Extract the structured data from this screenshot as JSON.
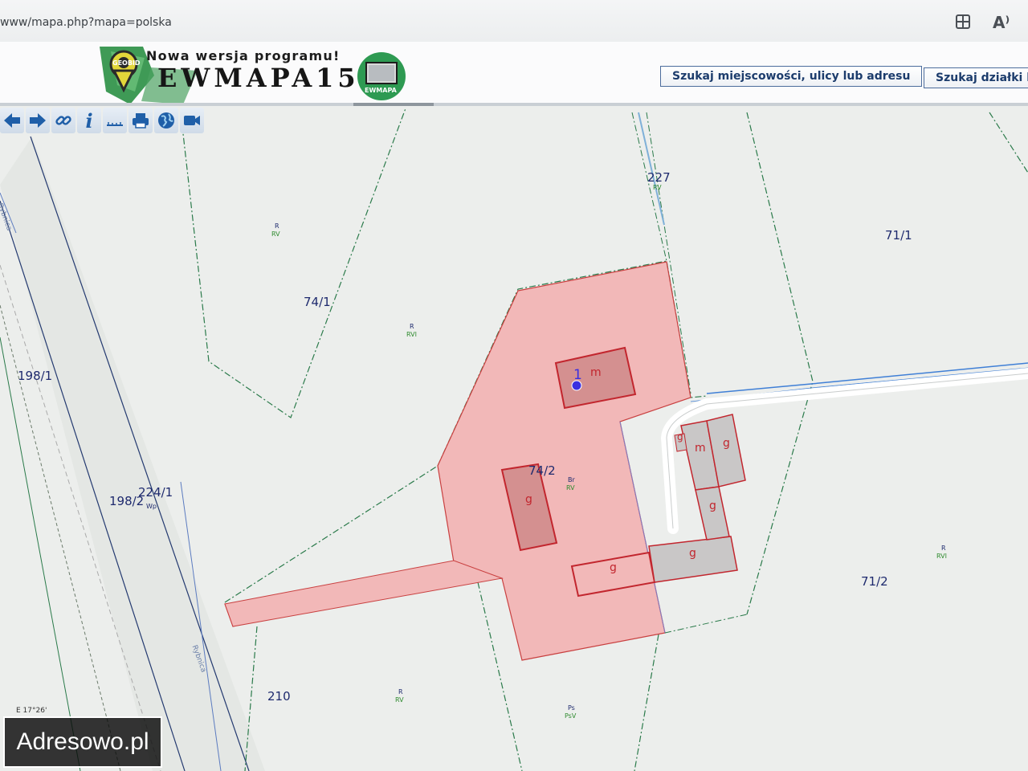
{
  "browser": {
    "url": "www/mapa.php?mapa=polska",
    "icons": [
      "split-view-icon",
      "read-aloud-icon"
    ],
    "read_aloud_glyph": "A⁾"
  },
  "header": {
    "tagline": "Nowa wersja programu!",
    "title": "EWMAPA15",
    "logo_small_text": "GEOBID",
    "monitor_caption": "EWMAPA",
    "search_address_label": "Szukaj miejscowości, ulicy lub adresu",
    "search_parcel_label": "Szukaj działki lu"
  },
  "toolbar": {
    "tools": [
      "back-icon",
      "forward-icon",
      "link-icon",
      "info-icon",
      "measure-icon",
      "print-icon",
      "globe-icon",
      "camera-icon"
    ],
    "info_glyph": "i"
  },
  "map": {
    "colors": {
      "parcel_fill": "#f2b8b8",
      "parcel_outline": "#c94040",
      "building_fill": "#d49090",
      "boundary": "#2a7a4a",
      "road_line": "#3f7fd6",
      "garage_fill": "#c9c7c7"
    },
    "parcels": {
      "p227": "227",
      "p71_1": "71/1",
      "p74_1": "74/1",
      "p198_1": "198/1",
      "p74_2": "74/2",
      "p224_1": "224/1",
      "p198_2": "198/2",
      "p71_2": "71/2",
      "p210": "210"
    },
    "land_use": {
      "rv_top_a": "R",
      "rv_top_b": "RV",
      "rvi_a": "R",
      "rvi_b": "RVI",
      "br_a": "Br",
      "br_b": "RV",
      "wp": "Wp",
      "rvi_right_a": "R",
      "rvi_right_b": "RVI",
      "rv_bottom_a": "R",
      "rv_bottom_b": "RV",
      "ps_a": "Ps",
      "ps_b": "PsV",
      "rv_227": "RV"
    },
    "buildings": {
      "house_floors": "1",
      "house_type": "m",
      "garage_left": "g",
      "shed_small": "g",
      "house_right": "m",
      "garage_right": "g",
      "garage_mid": "g",
      "garage_bottom": "g",
      "garage_long": "g"
    },
    "road_names": {
      "left_top": "Rybnica",
      "left_bottom": "Rybnica"
    },
    "coords": "E 17°26'"
  },
  "watermark": "Adresowo.pl"
}
